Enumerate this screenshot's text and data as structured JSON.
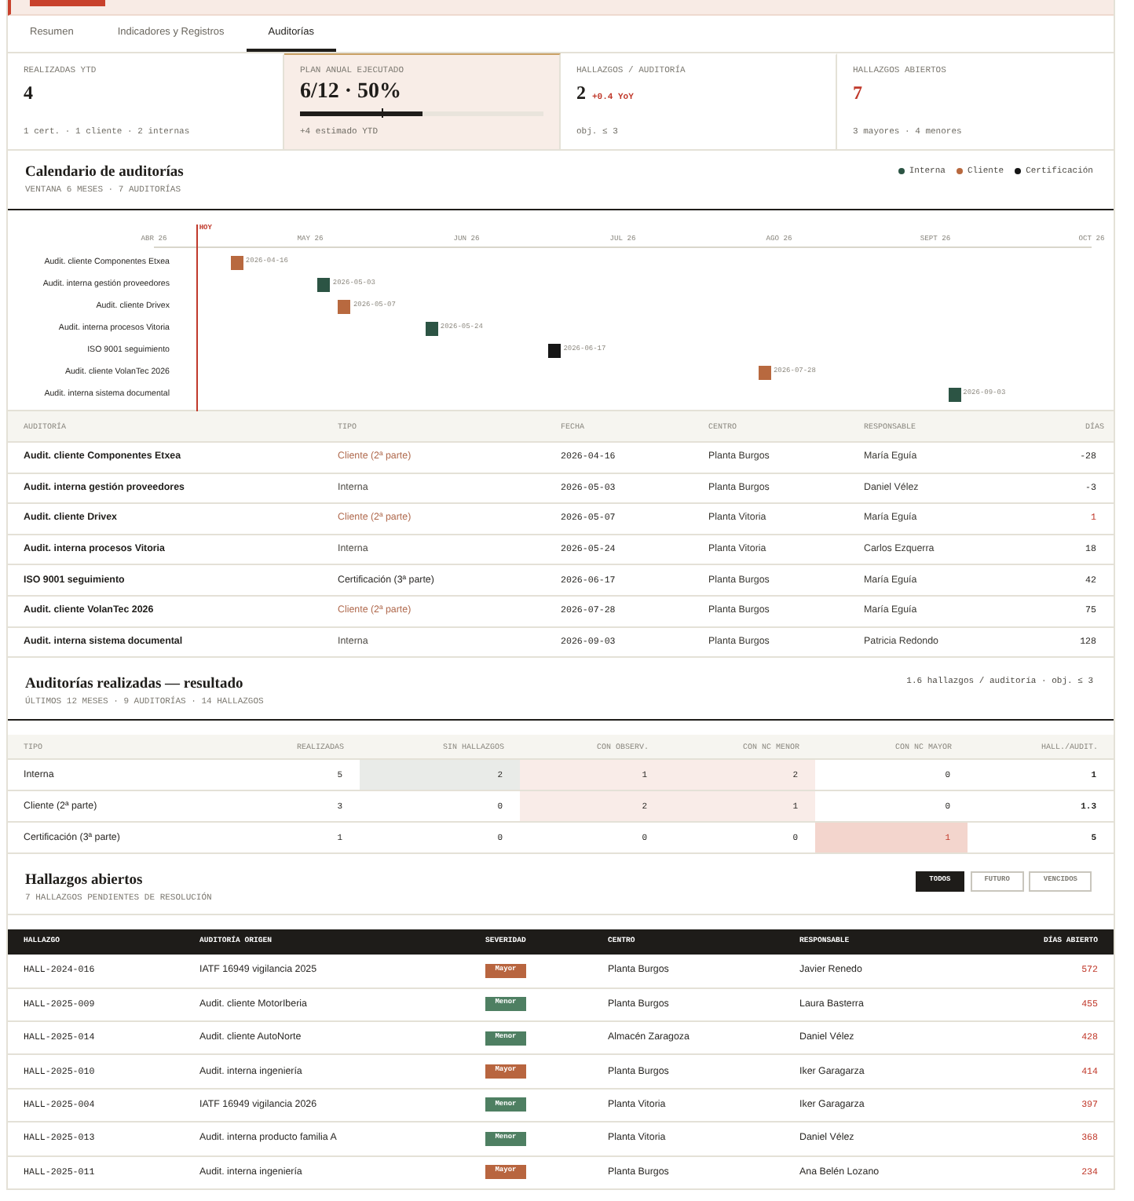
{
  "banner": {
    "alert": true
  },
  "tabs": [
    {
      "label": "Resumen",
      "selected": false
    },
    {
      "label": "Indicadores y Registros",
      "selected": false
    },
    {
      "label": "Auditorías",
      "selected": true
    }
  ],
  "kpis": [
    {
      "label": "REALIZADAS YTD",
      "value": "4",
      "note": "1 cert. · 1 cliente · 2 internas",
      "highlighted": false,
      "alert": false
    },
    {
      "label": "PLAN ANUAL EJECUTADO",
      "value": "6/12 · 50%",
      "progress": {
        "level": 0.5,
        "marker": {
          "level": 0.333
        }
      },
      "note": "+4 estimado YTD",
      "highlighted": true,
      "alert": false
    },
    {
      "label": "HALLAZGOS / AUDITORÍA",
      "value": "2",
      "delta": "+0.4 YoY",
      "note": "obj. ≤ 3",
      "highlighted": false,
      "alert": false
    },
    {
      "label": "HALLAZGOS ABIERTOS",
      "value": "7",
      "note": "3 mayores · 4 menores",
      "highlighted": false,
      "alert": true
    }
  ],
  "calendar": {
    "title": "Calendario de auditorías",
    "subtitle": "VENTANA 6 MESES · 7 AUDITORÍAS",
    "legend": [
      {
        "label": "Interna",
        "color": "#2c5444"
      },
      {
        "label": "Cliente",
        "color": "#b8693f"
      },
      {
        "label": "Certificación",
        "color": "#161616"
      }
    ],
    "months": [
      "ABR 26",
      "MAY 26",
      "JUN 26",
      "JUL 26",
      "AGO 26",
      "SEPT 26",
      "OCT 26"
    ],
    "today": {
      "label": "HOY",
      "level": 0.045
    },
    "rows": [
      {
        "label": "Audit. cliente Componentes Etxea",
        "date": "2026-04-16",
        "color": "#b8693f"
      },
      {
        "label": "Audit. interna gestión proveedores",
        "date": "2026-05-03",
        "color": "#2c5444"
      },
      {
        "label": "Audit. cliente Drivex",
        "date": "2026-05-07",
        "color": "#b8693f"
      },
      {
        "label": "Audit. interna procesos Vitoria",
        "date": "2026-05-24",
        "color": "#2c5444"
      },
      {
        "label": "ISO 9001 seguimiento",
        "date": "2026-06-17",
        "color": "#161616"
      },
      {
        "label": "Audit. cliente VolanTec 2026",
        "date": "2026-07-28",
        "color": "#b8693f"
      },
      {
        "label": "Audit. interna sistema documental",
        "date": "2026-09-03",
        "color": "#2c5444"
      }
    ]
  },
  "audits": {
    "columns": [
      "AUDITORÍA",
      "TIPO",
      "FECHA",
      "CENTRO",
      "RESPONSABLE",
      "DÍAS"
    ],
    "rows": [
      {
        "name": "Audit. cliente Componentes Etxea",
        "type": "Cliente (2ª parte)",
        "kind": "cliente",
        "date": "2026-04-16",
        "center": "Planta Burgos",
        "owner": "María Eguía",
        "days": "-28",
        "alert": false
      },
      {
        "name": "Audit. interna gestión proveedores",
        "type": "Interna",
        "kind": "interna",
        "date": "2026-05-03",
        "center": "Planta Burgos",
        "owner": "Daniel Vélez",
        "days": "-3",
        "alert": false
      },
      {
        "name": "Audit. cliente Drivex",
        "type": "Cliente (2ª parte)",
        "kind": "cliente",
        "date": "2026-05-07",
        "center": "Planta Vitoria",
        "owner": "María Eguía",
        "days": "1",
        "alert": true
      },
      {
        "name": "Audit. interna procesos Vitoria",
        "type": "Interna",
        "kind": "interna",
        "date": "2026-05-24",
        "center": "Planta Vitoria",
        "owner": "Carlos Ezquerra",
        "days": "18",
        "alert": false
      },
      {
        "name": "ISO 9001 seguimiento",
        "type": "Certificación (3ª parte)",
        "kind": "certificacion",
        "date": "2026-06-17",
        "center": "Planta Burgos",
        "owner": "María Eguía",
        "days": "42",
        "alert": false
      },
      {
        "name": "Audit. cliente VolanTec 2026",
        "type": "Cliente (2ª parte)",
        "kind": "cliente",
        "date": "2026-07-28",
        "center": "Planta Burgos",
        "owner": "María Eguía",
        "days": "75",
        "alert": false
      },
      {
        "name": "Audit. interna sistema documental",
        "type": "Interna",
        "kind": "interna",
        "date": "2026-09-03",
        "center": "Planta Burgos",
        "owner": "Patricia Redondo",
        "days": "128",
        "alert": false
      }
    ]
  },
  "results": {
    "title": "Auditorías realizadas — resultado",
    "subtitle": "ÚLTIMOS 12 MESES · 9 AUDITORÍAS · 14 HALLAZGOS",
    "summary": "1.6 hallazgos / auditoría · obj. ≤ 3",
    "columns": [
      "TIPO",
      "REALIZADAS",
      "SIN HALLAZGOS",
      "CON OBSERV.",
      "CON NC MENOR",
      "CON NC MAYOR",
      "HALL./AUDIT."
    ],
    "rows": [
      {
        "cells": [
          {
            "value": "Interna",
            "kind": "label"
          },
          {
            "value": "5",
            "kind": "plain"
          },
          {
            "value": "2",
            "kind": "neutral"
          },
          {
            "value": "1",
            "kind": "light"
          },
          {
            "value": "2",
            "kind": "light"
          },
          {
            "value": "0",
            "kind": "plain"
          },
          {
            "value": "1",
            "kind": "total"
          }
        ]
      },
      {
        "cells": [
          {
            "value": "Cliente (2ª parte)",
            "kind": "label"
          },
          {
            "value": "3",
            "kind": "plain"
          },
          {
            "value": "0",
            "kind": "plain"
          },
          {
            "value": "2",
            "kind": "light"
          },
          {
            "value": "1",
            "kind": "light"
          },
          {
            "value": "0",
            "kind": "plain"
          },
          {
            "value": "1.3",
            "kind": "total"
          }
        ]
      },
      {
        "cells": [
          {
            "value": "Certificación (3ª parte)",
            "kind": "label"
          },
          {
            "value": "1",
            "kind": "plain"
          },
          {
            "value": "0",
            "kind": "plain"
          },
          {
            "value": "0",
            "kind": "plain"
          },
          {
            "value": "0",
            "kind": "plain"
          },
          {
            "value": "1",
            "kind": "strong"
          },
          {
            "value": "5",
            "kind": "total"
          }
        ]
      }
    ]
  },
  "findings": {
    "title": "Hallazgos abiertos",
    "subtitle": "7 HALLAZGOS PENDIENTES DE RESOLUCIÓN",
    "filters": [
      {
        "label": "TODOS",
        "selected": true
      },
      {
        "label": "FUTURO",
        "selected": false
      },
      {
        "label": "VENCIDOS",
        "selected": false
      }
    ],
    "columns": [
      "HALLAZGO",
      "AUDITORÍA ORIGEN",
      "SEVERIDAD",
      "CENTRO",
      "RESPONSABLE",
      "DÍAS ABIERTO"
    ],
    "rows": [
      {
        "id": "HALL-2024-016",
        "audit": "IATF 16949 vigilancia 2025",
        "severity": "Mayor",
        "kind": "mayor",
        "center": "Planta Burgos",
        "owner": "Javier Renedo",
        "days": "572"
      },
      {
        "id": "HALL-2025-009",
        "audit": "Audit. cliente MotorIberia",
        "severity": "Menor",
        "kind": "menor",
        "center": "Planta Burgos",
        "owner": "Laura Basterra",
        "days": "455"
      },
      {
        "id": "HALL-2025-014",
        "audit": "Audit. cliente AutoNorte",
        "severity": "Menor",
        "kind": "menor",
        "center": "Almacén Zaragoza",
        "owner": "Daniel Vélez",
        "days": "428"
      },
      {
        "id": "HALL-2025-010",
        "audit": "Audit. interna ingeniería",
        "severity": "Mayor",
        "kind": "mayor",
        "center": "Planta Burgos",
        "owner": "Iker Garagarza",
        "days": "414"
      },
      {
        "id": "HALL-2025-004",
        "audit": "IATF 16949 vigilancia 2026",
        "severity": "Menor",
        "kind": "menor",
        "center": "Planta Vitoria",
        "owner": "Iker Garagarza",
        "days": "397"
      },
      {
        "id": "HALL-2025-013",
        "audit": "Audit. interna producto familia A",
        "severity": "Menor",
        "kind": "menor",
        "center": "Planta Vitoria",
        "owner": "Daniel Vélez",
        "days": "368"
      },
      {
        "id": "HALL-2025-011",
        "audit": "Audit. interna ingeniería",
        "severity": "Mayor",
        "kind": "mayor",
        "center": "Planta Burgos",
        "owner": "Ana Belén Lozano",
        "days": "234"
      }
    ]
  }
}
